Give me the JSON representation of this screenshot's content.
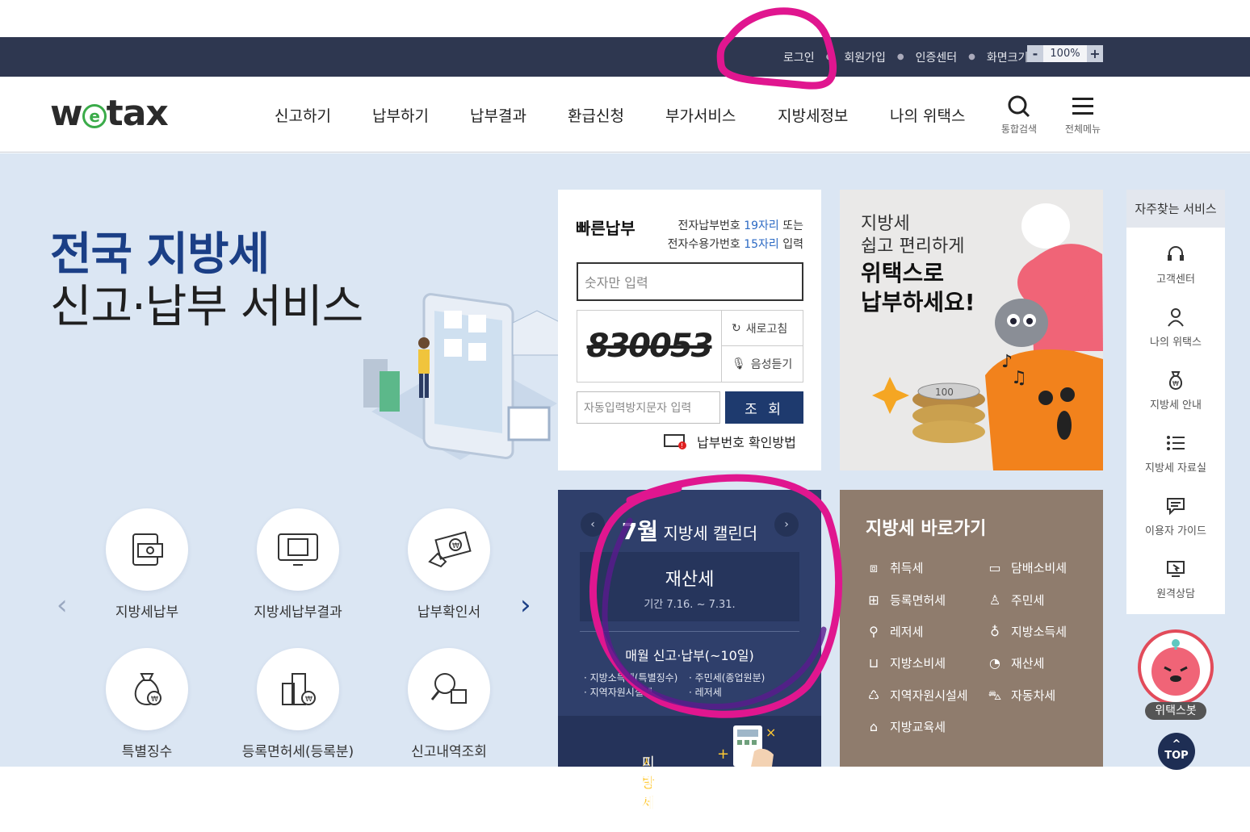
{
  "topbar": {
    "links": [
      "로그인",
      "회원가입",
      "인증센터",
      "화면크기"
    ],
    "zoom_minus": "-",
    "zoom_value": "100%",
    "zoom_plus": "+"
  },
  "header": {
    "logo": {
      "w": "w",
      "e": "e",
      "rest": "tax"
    },
    "nav": [
      "신고하기",
      "납부하기",
      "납부결과",
      "환급신청",
      "부가서비스",
      "지방세정보",
      "나의 위택스"
    ],
    "search_label": "통합검색",
    "menu_label": "전체메뉴"
  },
  "hero": {
    "line1": "전국 지방세",
    "line2": "신고·납부 서비스"
  },
  "services": [
    {
      "label": "지방세납부"
    },
    {
      "label": "지방세납부결과"
    },
    {
      "label": "납부확인서"
    },
    {
      "label": "특별징수"
    },
    {
      "label": "등록면허세(등록분)"
    },
    {
      "label": "신고내역조회"
    }
  ],
  "quickpay": {
    "title": "빠른납부",
    "desc1_pre": "전자납부번호 ",
    "desc1_hl": "19자리",
    "desc1_post": " 또는",
    "desc2_pre": "전자수용가번호 ",
    "desc2_hl": "15자리",
    "desc2_post": " 입력",
    "input_placeholder": "숫자만 입력",
    "captcha_text": "830053",
    "refresh_label": "새로고침",
    "audio_label": "음성듣기",
    "captcha_placeholder": "자동입력방지문자 입력",
    "submit_label": "조 회",
    "howto_label": "납부번호 확인방법"
  },
  "banner": {
    "line1": "지방세",
    "line2": "쉽고 편리하게",
    "line3": "위택스로",
    "line4": "납부하세요!",
    "coin_text": "100"
  },
  "calendar": {
    "month": "7월",
    "title": " 지방세 캘린더",
    "tax_name": "재산세",
    "period": "기간 7.16. ~ 7.31.",
    "monthly_heading": "매월 신고·납부(~10일)",
    "items": [
      "지방소득세(특별징수)",
      "주민세(종업원분)",
      "지역자원시설세",
      "레저세"
    ],
    "bottom_hl": "지방세",
    "bottom_rest": " 미리 계산"
  },
  "shortcuts": {
    "title": "지방세 바로가기",
    "items": [
      "취득세",
      "담배소비세",
      "등록면허세",
      "주민세",
      "레저세",
      "지방소득세",
      "지방소비세",
      "재산세",
      "지역자원시설세",
      "자동차세",
      "지방교육세"
    ]
  },
  "sidebar": {
    "title": "자주찾는 서비스",
    "items": [
      "고객센터",
      "나의 위택스",
      "지방세 안내",
      "지방세 자료실",
      "이용자 가이드",
      "원격상담"
    ]
  },
  "chatbot_label": "위택스봇",
  "top_label": "TOP",
  "colors": {
    "topbar": "#2e3750",
    "brand_navy": "#1b3f86",
    "main_bg": "#dbe6f3",
    "calendar_bg": "#2f3f6b",
    "shortcut_bg": "#8f7c6d",
    "logo_green": "#3aab49",
    "annotation_magenta": "#e0168f"
  }
}
